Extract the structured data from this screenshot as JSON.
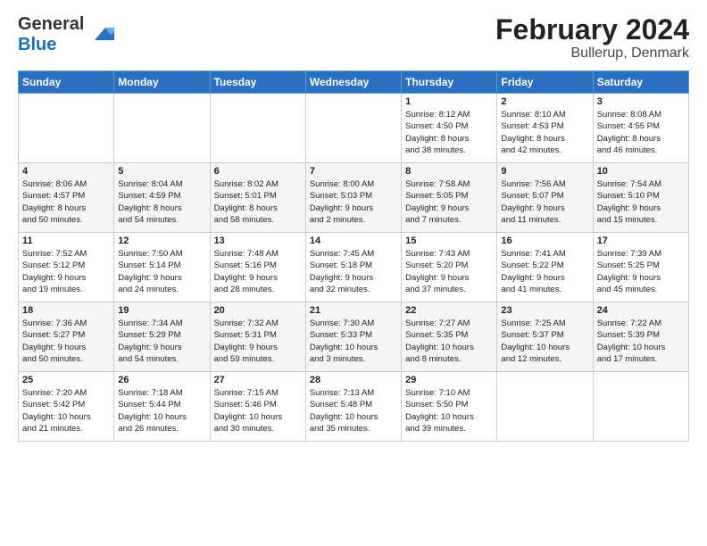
{
  "logo": {
    "line1": "General",
    "line2": "Blue"
  },
  "title": "February 2024",
  "subtitle": "Bullerup, Denmark",
  "days_of_week": [
    "Sunday",
    "Monday",
    "Tuesday",
    "Wednesday",
    "Thursday",
    "Friday",
    "Saturday"
  ],
  "weeks": [
    [
      {
        "day": "",
        "info": ""
      },
      {
        "day": "",
        "info": ""
      },
      {
        "day": "",
        "info": ""
      },
      {
        "day": "",
        "info": ""
      },
      {
        "day": "1",
        "info": "Sunrise: 8:12 AM\nSunset: 4:50 PM\nDaylight: 8 hours\nand 38 minutes."
      },
      {
        "day": "2",
        "info": "Sunrise: 8:10 AM\nSunset: 4:53 PM\nDaylight: 8 hours\nand 42 minutes."
      },
      {
        "day": "3",
        "info": "Sunrise: 8:08 AM\nSunset: 4:55 PM\nDaylight: 8 hours\nand 46 minutes."
      }
    ],
    [
      {
        "day": "4",
        "info": "Sunrise: 8:06 AM\nSunset: 4:57 PM\nDaylight: 8 hours\nand 50 minutes."
      },
      {
        "day": "5",
        "info": "Sunrise: 8:04 AM\nSunset: 4:59 PM\nDaylight: 8 hours\nand 54 minutes."
      },
      {
        "day": "6",
        "info": "Sunrise: 8:02 AM\nSunset: 5:01 PM\nDaylight: 8 hours\nand 58 minutes."
      },
      {
        "day": "7",
        "info": "Sunrise: 8:00 AM\nSunset: 5:03 PM\nDaylight: 9 hours\nand 2 minutes."
      },
      {
        "day": "8",
        "info": "Sunrise: 7:58 AM\nSunset: 5:05 PM\nDaylight: 9 hours\nand 7 minutes."
      },
      {
        "day": "9",
        "info": "Sunrise: 7:56 AM\nSunset: 5:07 PM\nDaylight: 9 hours\nand 11 minutes."
      },
      {
        "day": "10",
        "info": "Sunrise: 7:54 AM\nSunset: 5:10 PM\nDaylight: 9 hours\nand 15 minutes."
      }
    ],
    [
      {
        "day": "11",
        "info": "Sunrise: 7:52 AM\nSunset: 5:12 PM\nDaylight: 9 hours\nand 19 minutes."
      },
      {
        "day": "12",
        "info": "Sunrise: 7:50 AM\nSunset: 5:14 PM\nDaylight: 9 hours\nand 24 minutes."
      },
      {
        "day": "13",
        "info": "Sunrise: 7:48 AM\nSunset: 5:16 PM\nDaylight: 9 hours\nand 28 minutes."
      },
      {
        "day": "14",
        "info": "Sunrise: 7:45 AM\nSunset: 5:18 PM\nDaylight: 9 hours\nand 32 minutes."
      },
      {
        "day": "15",
        "info": "Sunrise: 7:43 AM\nSunset: 5:20 PM\nDaylight: 9 hours\nand 37 minutes."
      },
      {
        "day": "16",
        "info": "Sunrise: 7:41 AM\nSunset: 5:22 PM\nDaylight: 9 hours\nand 41 minutes."
      },
      {
        "day": "17",
        "info": "Sunrise: 7:39 AM\nSunset: 5:25 PM\nDaylight: 9 hours\nand 45 minutes."
      }
    ],
    [
      {
        "day": "18",
        "info": "Sunrise: 7:36 AM\nSunset: 5:27 PM\nDaylight: 9 hours\nand 50 minutes."
      },
      {
        "day": "19",
        "info": "Sunrise: 7:34 AM\nSunset: 5:29 PM\nDaylight: 9 hours\nand 54 minutes."
      },
      {
        "day": "20",
        "info": "Sunrise: 7:32 AM\nSunset: 5:31 PM\nDaylight: 9 hours\nand 59 minutes."
      },
      {
        "day": "21",
        "info": "Sunrise: 7:30 AM\nSunset: 5:33 PM\nDaylight: 10 hours\nand 3 minutes."
      },
      {
        "day": "22",
        "info": "Sunrise: 7:27 AM\nSunset: 5:35 PM\nDaylight: 10 hours\nand 8 minutes."
      },
      {
        "day": "23",
        "info": "Sunrise: 7:25 AM\nSunset: 5:37 PM\nDaylight: 10 hours\nand 12 minutes."
      },
      {
        "day": "24",
        "info": "Sunrise: 7:22 AM\nSunset: 5:39 PM\nDaylight: 10 hours\nand 17 minutes."
      }
    ],
    [
      {
        "day": "25",
        "info": "Sunrise: 7:20 AM\nSunset: 5:42 PM\nDaylight: 10 hours\nand 21 minutes."
      },
      {
        "day": "26",
        "info": "Sunrise: 7:18 AM\nSunset: 5:44 PM\nDaylight: 10 hours\nand 26 minutes."
      },
      {
        "day": "27",
        "info": "Sunrise: 7:15 AM\nSunset: 5:46 PM\nDaylight: 10 hours\nand 30 minutes."
      },
      {
        "day": "28",
        "info": "Sunrise: 7:13 AM\nSunset: 5:48 PM\nDaylight: 10 hours\nand 35 minutes."
      },
      {
        "day": "29",
        "info": "Sunrise: 7:10 AM\nSunset: 5:50 PM\nDaylight: 10 hours\nand 39 minutes."
      },
      {
        "day": "",
        "info": ""
      },
      {
        "day": "",
        "info": ""
      }
    ]
  ]
}
